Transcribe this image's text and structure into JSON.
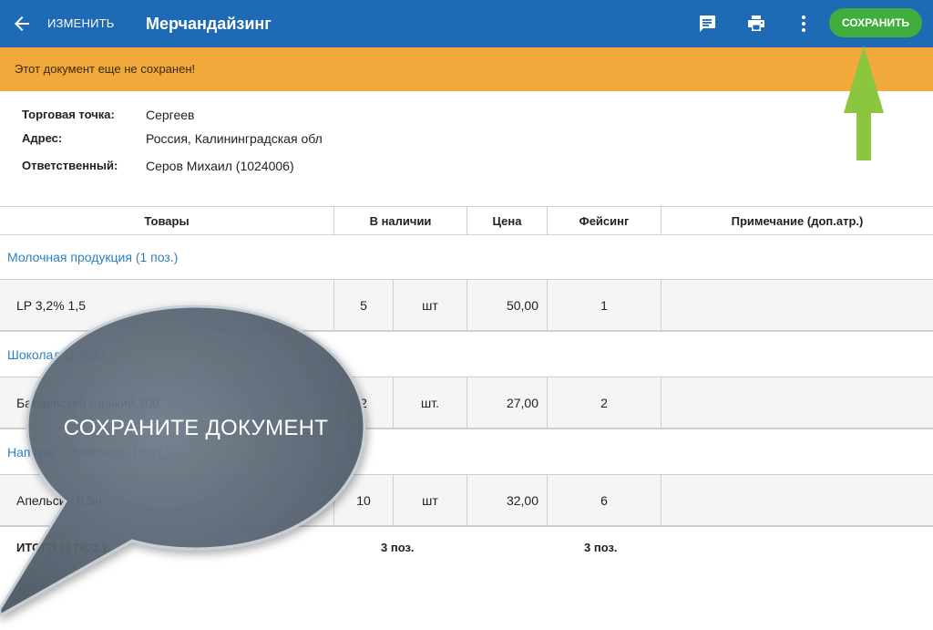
{
  "appbar": {
    "edit_label": "ИЗМЕНИТЬ",
    "title": "Мерчандайзинг",
    "save_label": "СОХРАНИТЬ",
    "icons": [
      "back-arrow-icon",
      "comment-icon",
      "print-icon",
      "more-vert-icon"
    ]
  },
  "banner": {
    "text": "Этот документ еще не сохранен!"
  },
  "info": {
    "outlet_label": "Торговая точка:",
    "outlet_value": "Сергеев",
    "address_label": "Адрес:",
    "address_value": "Россия, Калининградская обл",
    "responsible_label": "Ответственный:",
    "responsible_value": "Серов Михаил (1024006)"
  },
  "table": {
    "headers": [
      "Товары",
      "В наличии",
      "Цена",
      "Фейсинг",
      "Примечание (доп.атр.)"
    ],
    "groups": [
      {
        "title": "Молочная продукция (1 поз.)",
        "row": {
          "name": "LP 3,2% 1,5",
          "qty": "5",
          "unit": "шт",
          "price": "50,00",
          "facing": "1",
          "note": ""
        }
      },
      {
        "title": "Шоколад (1 поз.)",
        "row": {
          "name": "Бабаевский горький 100",
          "qty": "2",
          "unit": "шт.",
          "price": "27,00",
          "facing": "2",
          "note": ""
        }
      },
      {
        "title": "Напитки » Лимонад (1 поз.)",
        "row": {
          "name": "Апельсин 0,5л",
          "qty": "10",
          "unit": "шт",
          "price": "32,00",
          "facing": "6",
          "note": ""
        }
      }
    ],
    "total": {
      "label": "ИТОГО (3 ПОЗ.)",
      "qty": "3 поз.",
      "facing": "3 поз."
    }
  },
  "annotation": {
    "callout_text": "СОХРАНИТЕ ДОКУМЕНТ",
    "arrow_color": "#8cc63f",
    "callout_color": "#5d6a78"
  },
  "colors": {
    "appbar": "#1e6ab4",
    "banner": "#f2a93b",
    "save_button": "#3fae3f",
    "group_link": "#2f7fbf"
  }
}
